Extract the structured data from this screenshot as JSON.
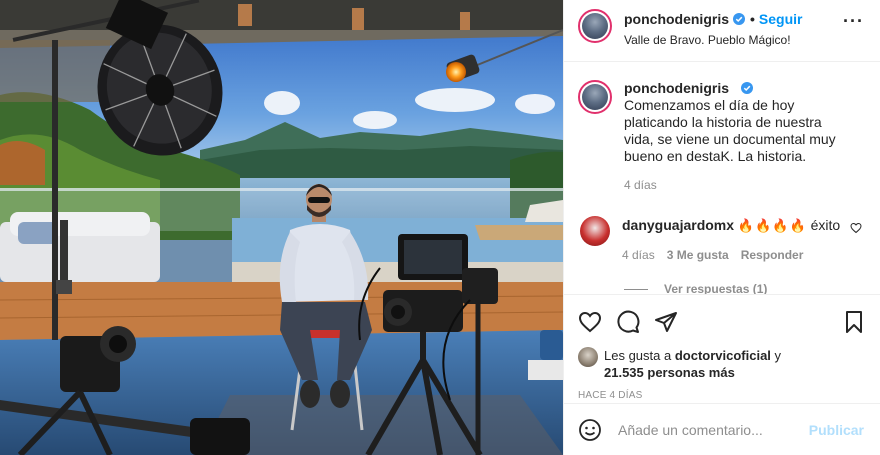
{
  "post": {
    "image_alt": "Man seated on a stool in front of a camera rig, overlooking a lake and mountains"
  },
  "header": {
    "username": "ponchodenigris",
    "separator": "•",
    "follow_label": "Seguir",
    "location": "Valle de Bravo. Pueblo Mágico!",
    "more_icon": "more-horizontal-icon"
  },
  "caption": {
    "username": "ponchodenigris",
    "text": "Comenzamos el día de hoy platicando la historia de nuestra vida, se viene un documental muy bueno en destaK. La historia.",
    "time": "4 días"
  },
  "comments": [
    {
      "username": "danyguajardomx",
      "emoji": "🔥🔥🔥🔥",
      "text": "éxito",
      "time": "4 días",
      "likes": "3 Me gusta",
      "reply_label": "Responder",
      "view_replies": "Ver respuestas (1)"
    }
  ],
  "actions": {
    "likes_prefix": "Les gusta a",
    "likes_user": "doctorvicoficial",
    "likes_conj": "y",
    "likes_count": "21.535 personas más",
    "date": "HACE 4 DÍAS"
  },
  "add_comment": {
    "placeholder": "Añade un comentario...",
    "publish_label": "Publicar"
  },
  "colors": {
    "link_blue": "#0095f6",
    "publish_disabled": "#b2dffc",
    "verified_blue": "#3897f0",
    "muted_text": "#8e8e8e"
  }
}
